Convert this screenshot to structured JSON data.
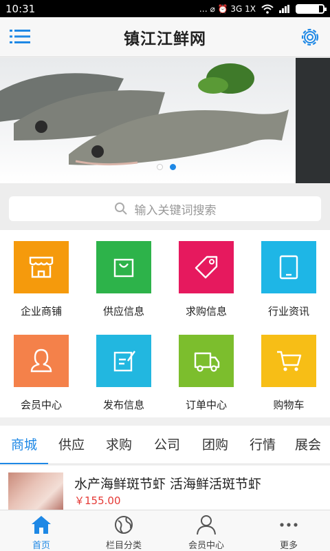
{
  "status_bar": {
    "time": "10:31",
    "icons_text": "… ⌀ ⏰ 3G 1X"
  },
  "app_bar": {
    "title": "镇江江鲜网"
  },
  "banner": {
    "slide_count": 2,
    "active_index": 1
  },
  "search": {
    "placeholder": "输入关键词搜索"
  },
  "grid": {
    "items": [
      {
        "label": "企业商铺",
        "color": "#F59A0C",
        "icon": "store-icon"
      },
      {
        "label": "供应信息",
        "color": "#2DB34A",
        "icon": "shopping-bag-icon"
      },
      {
        "label": "求购信息",
        "color": "#E6195E",
        "icon": "price-tag-icon"
      },
      {
        "label": "行业资讯",
        "color": "#1EB6E6",
        "icon": "tablet-icon"
      },
      {
        "label": "会员中心",
        "color": "#F4814A",
        "icon": "user-icon"
      },
      {
        "label": "发布信息",
        "color": "#22B7E0",
        "icon": "edit-icon"
      },
      {
        "label": "订单中心",
        "color": "#7CBE2D",
        "icon": "truck-icon"
      },
      {
        "label": "购物车",
        "color": "#F7BE16",
        "icon": "cart-icon"
      }
    ]
  },
  "tabs": [
    "商城",
    "供应",
    "求购",
    "公司",
    "团购",
    "行情",
    "展会"
  ],
  "product": {
    "title": "水产海鲜斑节虾 活海鲜活斑节虾",
    "price": "￥155.00"
  },
  "bottom_nav": [
    {
      "label": "首页",
      "icon": "home-icon",
      "active": true
    },
    {
      "label": "栏目分类",
      "icon": "category-icon",
      "active": false
    },
    {
      "label": "会员中心",
      "icon": "member-icon",
      "active": false
    },
    {
      "label": "更多",
      "icon": "more-icon",
      "active": false
    }
  ],
  "colors": {
    "accent": "#1E88E5",
    "price": "#E53935"
  }
}
